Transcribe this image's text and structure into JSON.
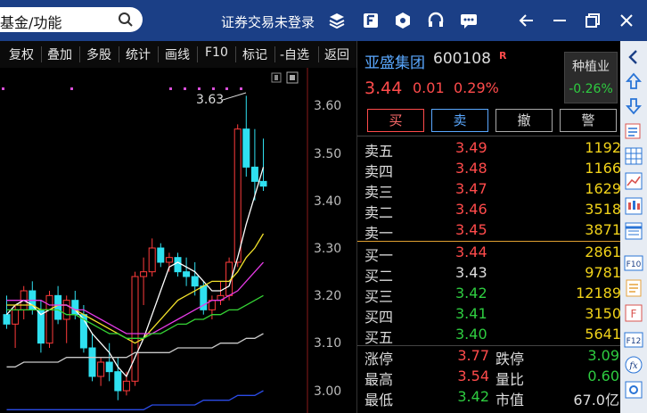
{
  "titlebar": {
    "search_text": "基金/功能",
    "login_text": "证券交易未登录",
    "icons": [
      "layers-icon",
      "f-square-icon",
      "hexagon-icon",
      "headset-icon",
      "chat-icon"
    ],
    "window": [
      "back-arrow-icon",
      "minimize-icon",
      "restore-icon",
      "close-icon"
    ]
  },
  "toolbar": {
    "items": [
      "复权",
      "叠加",
      "多股",
      "统计",
      "画线",
      "F10",
      "标记",
      "-自选",
      "返回"
    ]
  },
  "chart": {
    "peak_label": "3.63",
    "y_axis_labels": [
      "3.60",
      "3.50",
      "3.40",
      "3.30",
      "3.20",
      "3.10",
      "3.00"
    ],
    "colors": {
      "up": "#ff3b3b",
      "down": "#2fe0f0",
      "ma5": "#ffffff",
      "ma10": "#f2e12b",
      "ma20": "#e63be6",
      "ma30": "#35d335",
      "ma60": "#c8c8c8",
      "ma120": "#2b4be6"
    }
  },
  "quote": {
    "name": "亚盛集团",
    "code": "600108",
    "badge": "R",
    "price": "3.44",
    "change": "0.01",
    "change_pct": "0.29%",
    "sector_name": "种植业",
    "sector_pct": "-0.26%",
    "actions": {
      "buy": "买",
      "sell": "卖",
      "cancel": "撤",
      "alert": "警"
    }
  },
  "orderbook": {
    "asks": [
      {
        "label": "卖五",
        "price": "3.49",
        "volume": "1192"
      },
      {
        "label": "卖四",
        "price": "3.48",
        "volume": "1166"
      },
      {
        "label": "卖三",
        "price": "3.47",
        "volume": "1629"
      },
      {
        "label": "卖二",
        "price": "3.46",
        "volume": "3518"
      },
      {
        "label": "卖一",
        "price": "3.45",
        "volume": "3871"
      }
    ],
    "bids": [
      {
        "label": "买一",
        "price": "3.44",
        "volume": "2861"
      },
      {
        "label": "买二",
        "price": "3.43",
        "volume": "9781"
      },
      {
        "label": "买三",
        "price": "3.42",
        "volume": "12189"
      },
      {
        "label": "买四",
        "price": "3.41",
        "volume": "3150"
      },
      {
        "label": "买五",
        "price": "3.40",
        "volume": "5641"
      }
    ]
  },
  "stats": {
    "limit_up_label": "涨停",
    "limit_up": "3.77",
    "limit_down_label": "跌停",
    "limit_down": "3.09",
    "high_label": "最高",
    "high": "3.54",
    "volume_ratio_label": "量比",
    "volume_ratio": "0.60",
    "low_label": "最低",
    "low": "3.42",
    "market_cap_label": "市值",
    "market_cap": "67.0亿"
  },
  "right_panel": {
    "buttons": [
      "chevron-left-icon",
      "up-arrow-icon",
      "down-arrow-icon",
      "list-icon",
      "grid-icon",
      "line-chart-icon",
      "candlestick-icon",
      "table-icon",
      "f10-icon",
      "document-icon",
      "f-icon",
      "f12-icon",
      "fx-icon",
      "settings-icon"
    ]
  }
}
